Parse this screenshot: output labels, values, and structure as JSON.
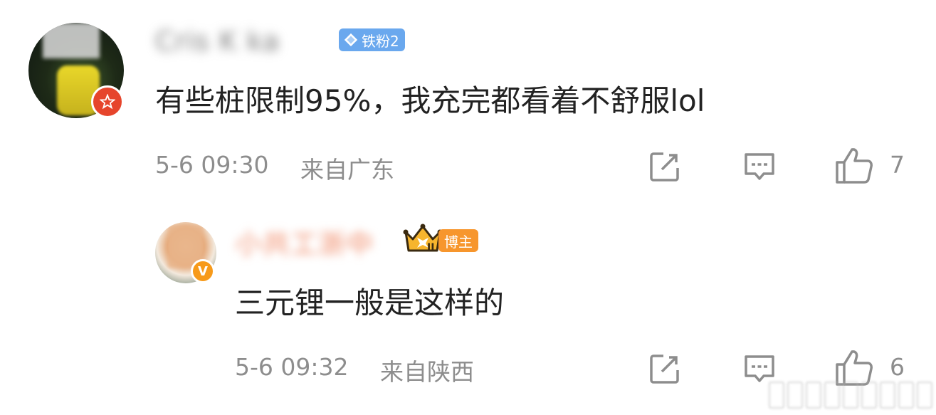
{
  "comments": [
    {
      "username": "Cris K  ka",
      "fan_badge": "铁粉2",
      "text": "有些桩限制95%，我充完都看着不舒服lol",
      "time": "5-6 09:30",
      "location": "来自广东",
      "likes": "7"
    },
    {
      "username": "小共工浙中",
      "blogger_badge": "博主",
      "crown_level": "II",
      "text": "三元锂一般是这样的",
      "time": "5-6 09:32",
      "location": "来自陕西",
      "likes": "6"
    }
  ],
  "icons": {
    "repost": "repost-icon",
    "reply": "comment-icon",
    "like": "thumbs-up-icon"
  },
  "colors": {
    "fan_tag": "#6aa8ee",
    "blogger_tag": "#f7962d",
    "meta_text": "#8d8d8d",
    "red_badge": "#e6452c",
    "verified_badge": "#f79a1a"
  }
}
